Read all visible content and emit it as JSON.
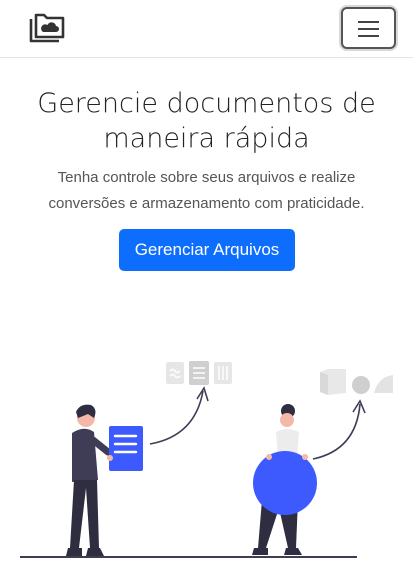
{
  "navbar": {
    "brand_icon": "folder-cloud-icon",
    "toggler_icon": "hamburger-menu-icon"
  },
  "hero": {
    "title_line1": "Gerencie documentos de",
    "title_line2": "maneira rápida",
    "subtitle_line1": "Tenha controle sobre seus arquivos e realize",
    "subtitle_line2": "conversões e armazenamento com praticidade.",
    "cta_label": "Gerenciar Arquivos"
  },
  "colors": {
    "primary": "#0d6efd",
    "illustration_accent": "#3d5afe",
    "illustration_dark": "#3f3d56",
    "illustration_gray": "#e0e0e0"
  }
}
